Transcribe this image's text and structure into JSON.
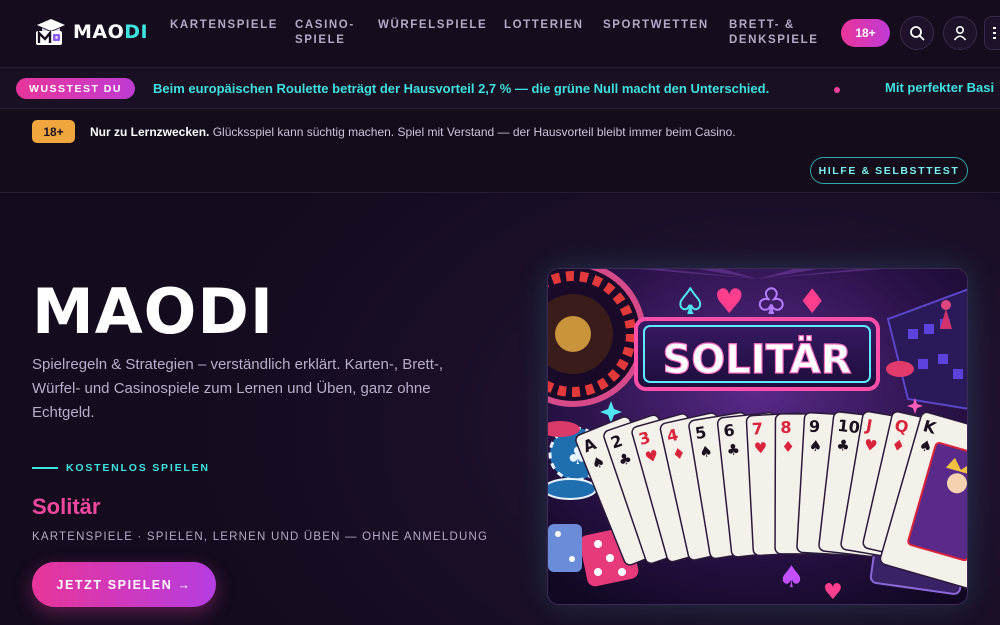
{
  "header": {
    "logo_a": "MAO",
    "logo_b": "DI",
    "nav": [
      {
        "l1": "KARTENSPIELE",
        "l2": ""
      },
      {
        "l1": "CASINO-",
        "l2": "SPIELE"
      },
      {
        "l1": "WÜRFELSPIELE",
        "l2": ""
      },
      {
        "l1": "LOTTERIEN",
        "l2": ""
      },
      {
        "l1": "SPORTWETTEN",
        "l2": ""
      },
      {
        "l1": "BRETT- &",
        "l2": "DENKSPIELE"
      }
    ],
    "age_badge": "18+",
    "icons": [
      "search-icon",
      "user-icon",
      "menu-icon"
    ]
  },
  "ticker": {
    "pill": "WUSSTEST DU",
    "text": "Beim europäischen Roulette beträgt der Hausvorteil 2,7 % — die grüne Null macht den Unterschied.",
    "text2": "Mit perfekter Basi"
  },
  "notice": {
    "badge": "18+",
    "bold": "Nur zu Lernzwecken.",
    "text": " Glücksspiel kann süchtig machen. Spiel mit Verstand — der Hausvorteil bleibt immer beim Casino.",
    "help": "HILFE & SELBSTTEST"
  },
  "hero": {
    "title": "MAODI",
    "description": "Spielregeln & Strategien – verständlich erklärt. Karten-, Brett-, Würfel- und Casinospiele zum Lernen und Üben, ganz ohne Echtgeld.",
    "kicker": "KOSTENLOS SPIELEN",
    "game_title": "Solitär",
    "game_meta": "KARTENSPIELE · SPIELEN, LERNEN UND ÜBEN — OHNE ANMELDUNG",
    "cta": "JETZT SPIELEN →",
    "image_sign": "SOLITÄR",
    "cards": [
      "A",
      "2",
      "3",
      "4",
      "5",
      "6",
      "7",
      "8",
      "9",
      "10",
      "J",
      "Q",
      "K"
    ]
  },
  "colors": {
    "accent_pink": "#e8359a",
    "accent_cyan": "#3ee3e0",
    "badge_orange": "#f0a63c",
    "bg": "#130c1c"
  }
}
